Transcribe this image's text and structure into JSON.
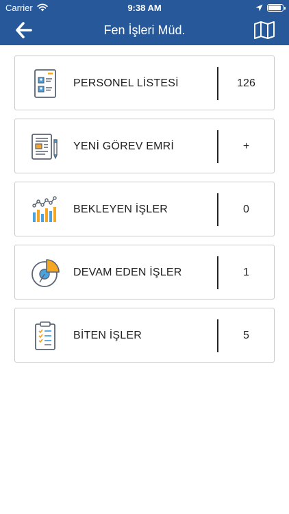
{
  "status_bar": {
    "carrier": "Carrier",
    "time": "9:38 AM"
  },
  "nav": {
    "title": "Fen İşleri Müd."
  },
  "menu": [
    {
      "label": "PERSONEL LİSTESİ",
      "value": "126",
      "icon": "personnel-list-icon"
    },
    {
      "label": "YENİ GÖREV EMRİ",
      "value": "+",
      "icon": "new-task-document-icon"
    },
    {
      "label": "BEKLEYEN İŞLER",
      "value": "0",
      "icon": "bar-chart-icon"
    },
    {
      "label": "DEVAM EDEN İŞLER",
      "value": "1",
      "icon": "pie-chart-icon"
    },
    {
      "label": "BİTEN İŞLER",
      "value": "5",
      "icon": "clipboard-checklist-icon"
    }
  ],
  "colors": {
    "header": "#26589a",
    "accent_orange": "#f5a623",
    "accent_blue": "#4aa3df",
    "icon_gray": "#5a6472"
  }
}
